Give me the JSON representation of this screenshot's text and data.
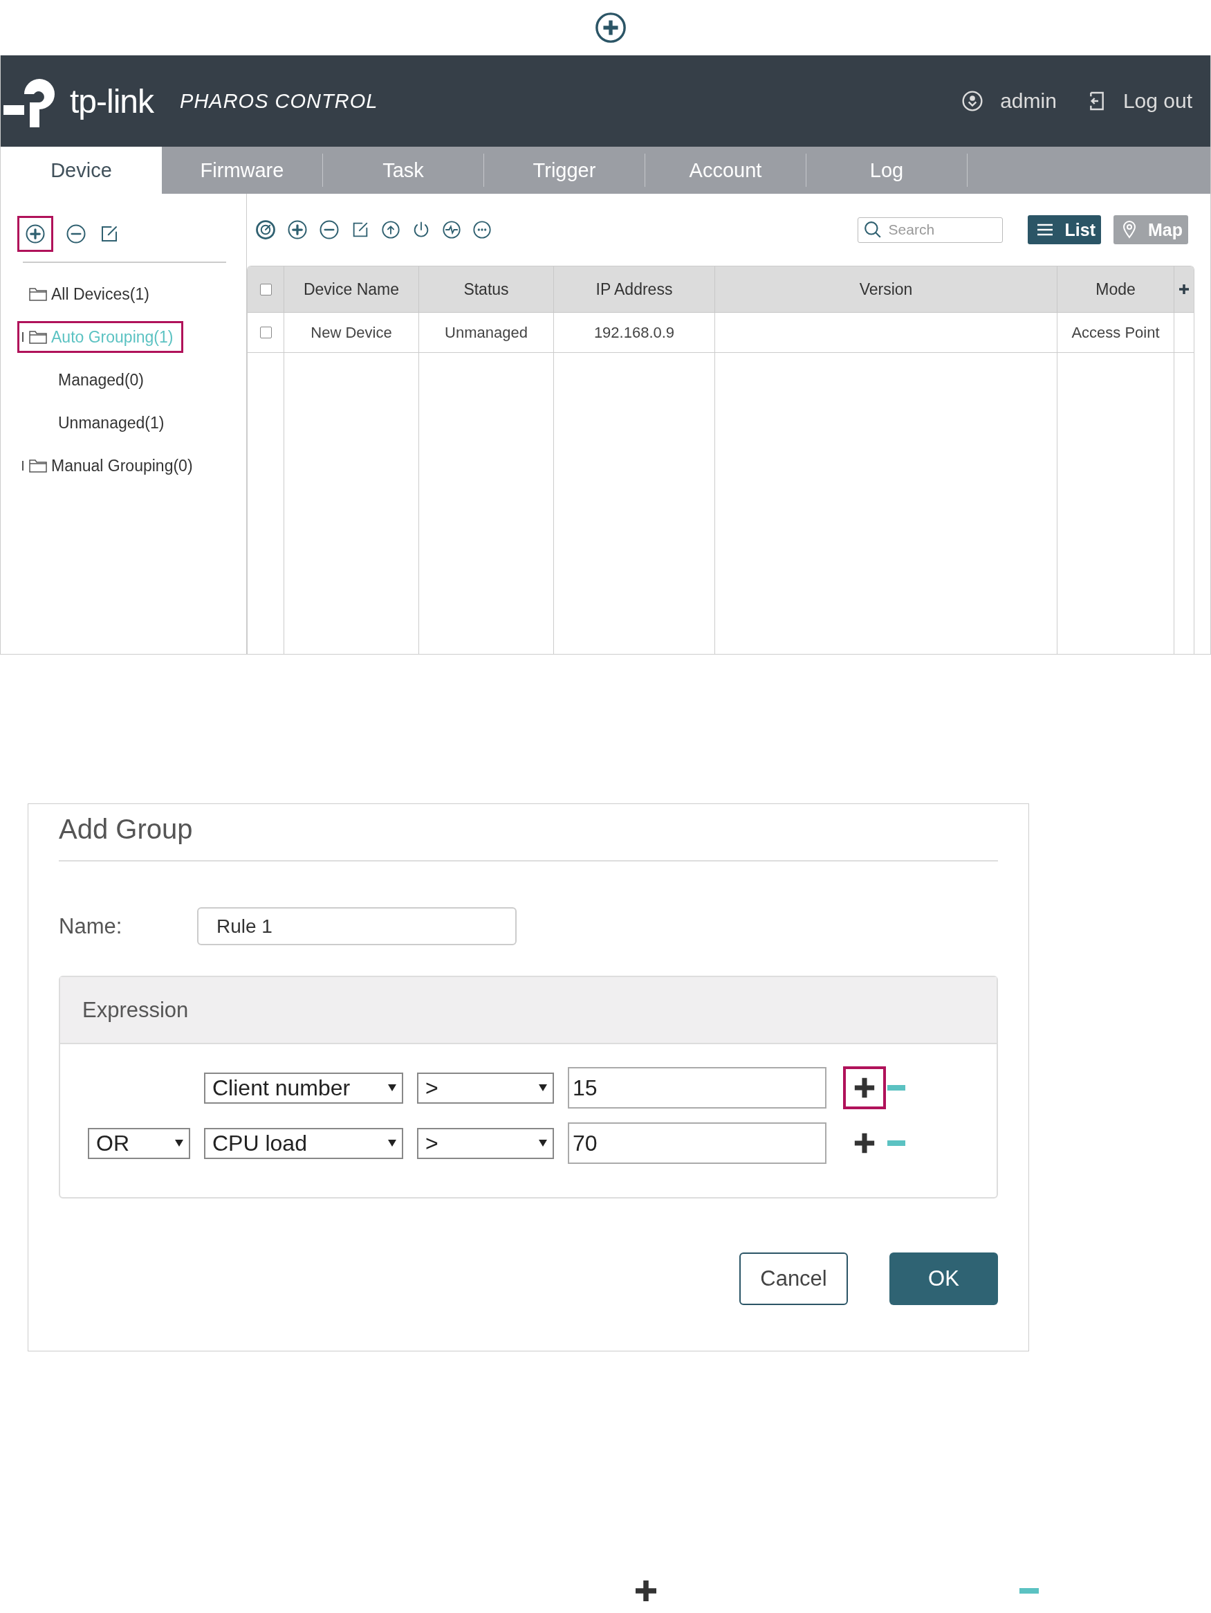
{
  "header": {
    "logo_text": "tp-link",
    "product": "**PHAROS** CONTROL",
    "user": "admin",
    "logout": "Log out"
  },
  "tabs": [
    {
      "label": "Device",
      "selected": true
    },
    {
      "label": "Firmware",
      "selected": false
    },
    {
      "label": "Task",
      "selected": false
    },
    {
      "label": "Trigger",
      "selected": false
    },
    {
      "label": "Account",
      "selected": false
    },
    {
      "label": "Log",
      "selected": false
    }
  ],
  "sidebar": {
    "add_highlighted": true,
    "tree": [
      {
        "label": "All Devices(1)",
        "selected": false,
        "highlighted": false,
        "expandable": false
      },
      {
        "label": "Auto Grouping(1)",
        "selected": true,
        "highlighted": true,
        "expandable": true,
        "children": [
          {
            "label": "Managed(0)",
            "selected": false,
            "highlighted": false
          },
          {
            "label": "Unmanaged(1)",
            "selected": false,
            "highlighted": false
          }
        ]
      },
      {
        "label": "Manual Grouping(0)",
        "selected": false,
        "highlighted": false,
        "expandable": true
      }
    ]
  },
  "search": {
    "placeholder": "Search"
  },
  "views": [
    {
      "label": "List",
      "selected": true
    },
    {
      "label": "Map",
      "selected": false
    }
  ],
  "table": {
    "all_checked": false,
    "columns": [
      "Device Name",
      "Status",
      "IP Address",
      "Version",
      "Mode"
    ],
    "rows": [
      {
        "checked": false,
        "cells": [
          "New Device",
          "Unmanaged",
          "192.168.0.9",
          null,
          "Access Point"
        ]
      }
    ]
  },
  "dialog": {
    "title": "Add Group",
    "name_label": "Name:",
    "name_value": "Rule 1",
    "expression_title": "Expression",
    "rules": [
      {
        "field": "Client number",
        "operator": ">",
        "value": "15",
        "add_highlighted": true
      },
      {
        "connector": "OR",
        "field": "CPU load",
        "operator": ">",
        "value": "70",
        "add_highlighted": false
      }
    ],
    "buttons": [
      {
        "label": "Cancel",
        "kind": "secondary"
      },
      {
        "label": "OK",
        "kind": "primary"
      }
    ]
  }
}
